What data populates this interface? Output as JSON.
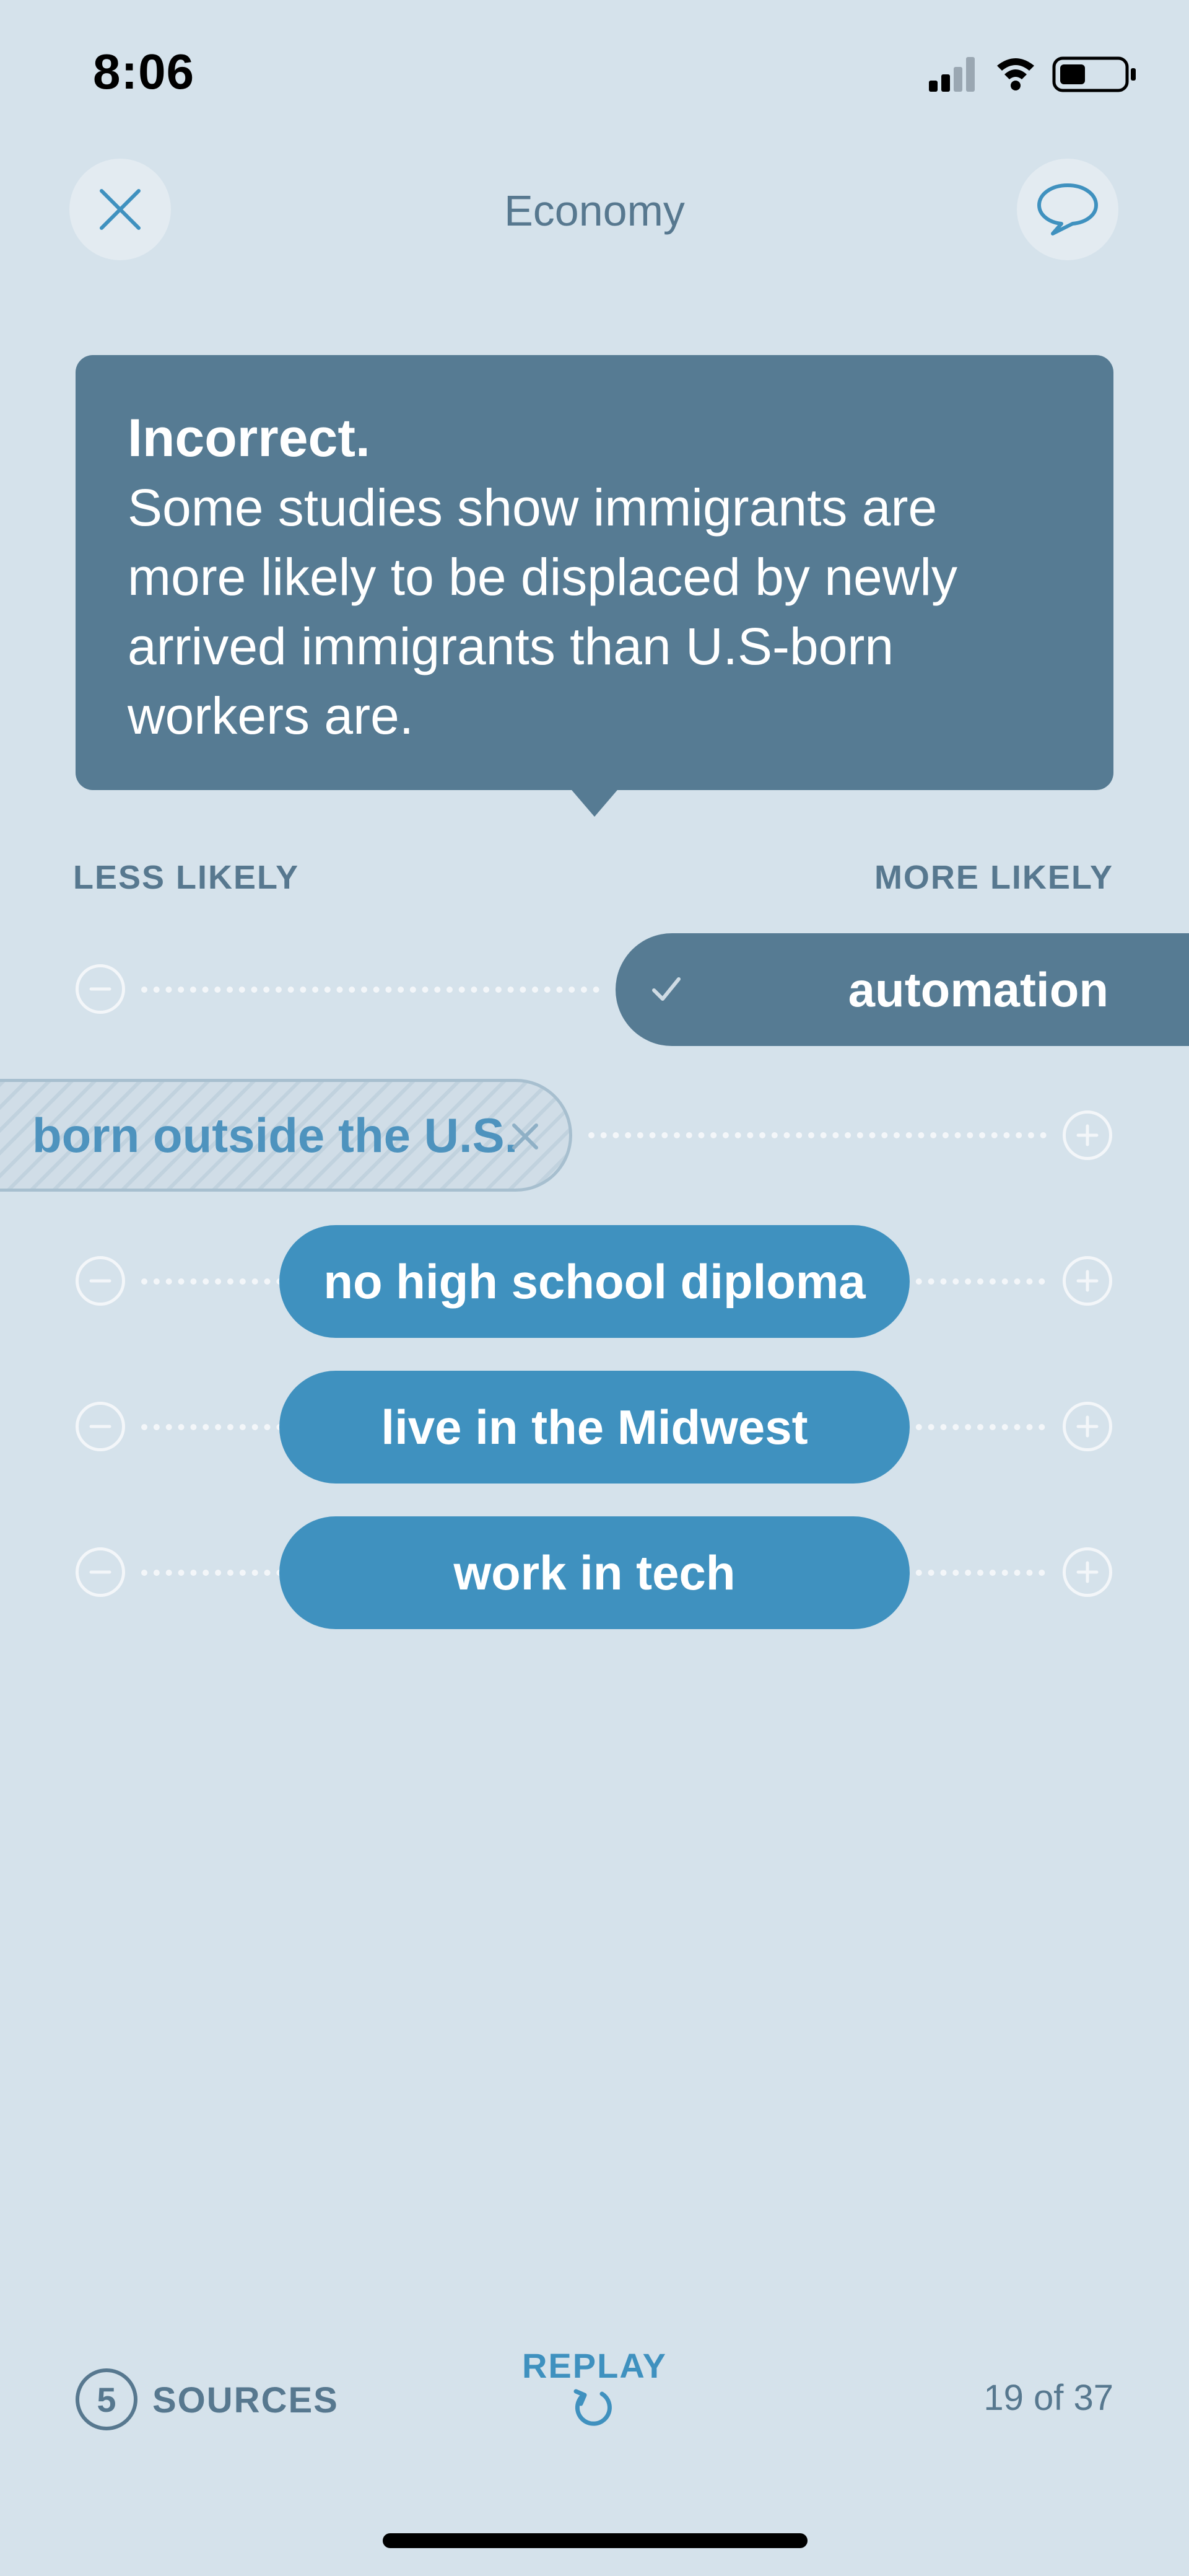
{
  "status_bar": {
    "time": "8:06"
  },
  "header": {
    "title": "Economy",
    "close_icon": "close-icon",
    "chat_icon": "chat-bubble-icon"
  },
  "feedback": {
    "title": "Incorrect.",
    "body": "Some studies show immigrants are more likely to be displaced by newly arrived immigrants than U.S-born workers are."
  },
  "scale": {
    "left_label": "LESS LIKELY",
    "right_label": "MORE LIKELY"
  },
  "rows": [
    {
      "label": "automation",
      "state": "correct"
    },
    {
      "label": "born outside the U.S.",
      "state": "incorrect"
    },
    {
      "label": "no high school diploma",
      "state": "neutral"
    },
    {
      "label": "live in the Midwest",
      "state": "neutral"
    },
    {
      "label": "work in tech",
      "state": "neutral"
    }
  ],
  "footer": {
    "sources_count": "5",
    "sources_label": "SOURCES",
    "replay_label": "REPLAY",
    "progress": "19 of 37"
  },
  "colors": {
    "background": "#d5e2eb",
    "card": "#567b93",
    "pill": "#3f91bf",
    "text_muted": "#57788f"
  }
}
